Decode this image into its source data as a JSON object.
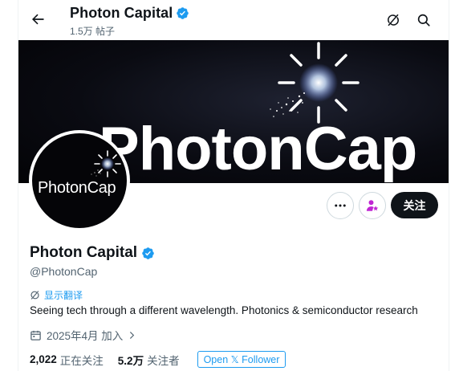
{
  "header": {
    "title": "Photon Capital",
    "post_count": "1.5万 帖子"
  },
  "banner": {
    "text": "PhotonCap"
  },
  "avatar": {
    "text": "PhotonCap"
  },
  "actions": {
    "follow_label": "关注"
  },
  "profile": {
    "name": "Photon Capital",
    "handle": "@PhotonCap",
    "translate_label": "显示翻译",
    "bio": "Seeing tech through a different wavelength. Photonics & semiconductor research",
    "joined": "2025年4月 加入"
  },
  "stats": {
    "following_count": "2,022",
    "following_label": "正在关注",
    "followers_count": "5.2万",
    "followers_label": "关注者"
  },
  "badge": {
    "open_follower": "Open 𝕏 Follower"
  },
  "colors": {
    "accent": "#1d9bf0",
    "text": "#0f1419",
    "muted": "#536471",
    "subscribe_icon": "#c026d3"
  },
  "icons": [
    "back-arrow-icon",
    "verified-icon",
    "grok-icon",
    "search-icon",
    "more-icon",
    "subscribe-icon",
    "translate-icon",
    "calendar-icon",
    "chevron-right-icon"
  ]
}
